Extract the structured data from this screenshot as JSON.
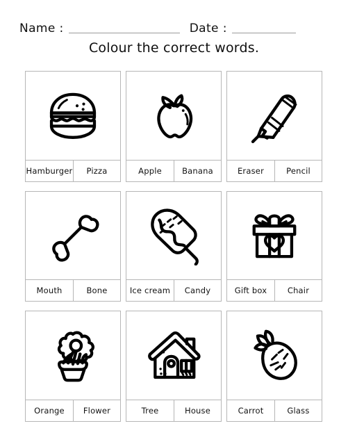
{
  "header": {
    "name_label": "Name :",
    "date_label": "Date :"
  },
  "title": "Colour the correct words.",
  "cards": [
    {
      "icon": "hamburger-icon",
      "words": [
        "Hamburger",
        "Pizza"
      ]
    },
    {
      "icon": "apple-icon",
      "words": [
        "Apple",
        "Banana"
      ]
    },
    {
      "icon": "pencil-icon",
      "words": [
        "Eraser",
        "Pencil"
      ]
    },
    {
      "icon": "bone-icon",
      "words": [
        "Mouth",
        "Bone"
      ]
    },
    {
      "icon": "popsicle-icon",
      "words": [
        "Ice cream",
        "Candy"
      ]
    },
    {
      "icon": "gift-box-icon",
      "words": [
        "Gift box",
        "Chair"
      ]
    },
    {
      "icon": "flower-pot-icon",
      "words": [
        "Orange",
        "Flower"
      ]
    },
    {
      "icon": "house-icon",
      "words": [
        "Tree",
        "House"
      ]
    },
    {
      "icon": "carrot-icon",
      "words": [
        "Carrot",
        "Glass"
      ]
    }
  ],
  "colors": {
    "ink": "#000000",
    "border": "#b6b6b6",
    "rule": "#9a9a9a",
    "background": "#ffffff"
  }
}
